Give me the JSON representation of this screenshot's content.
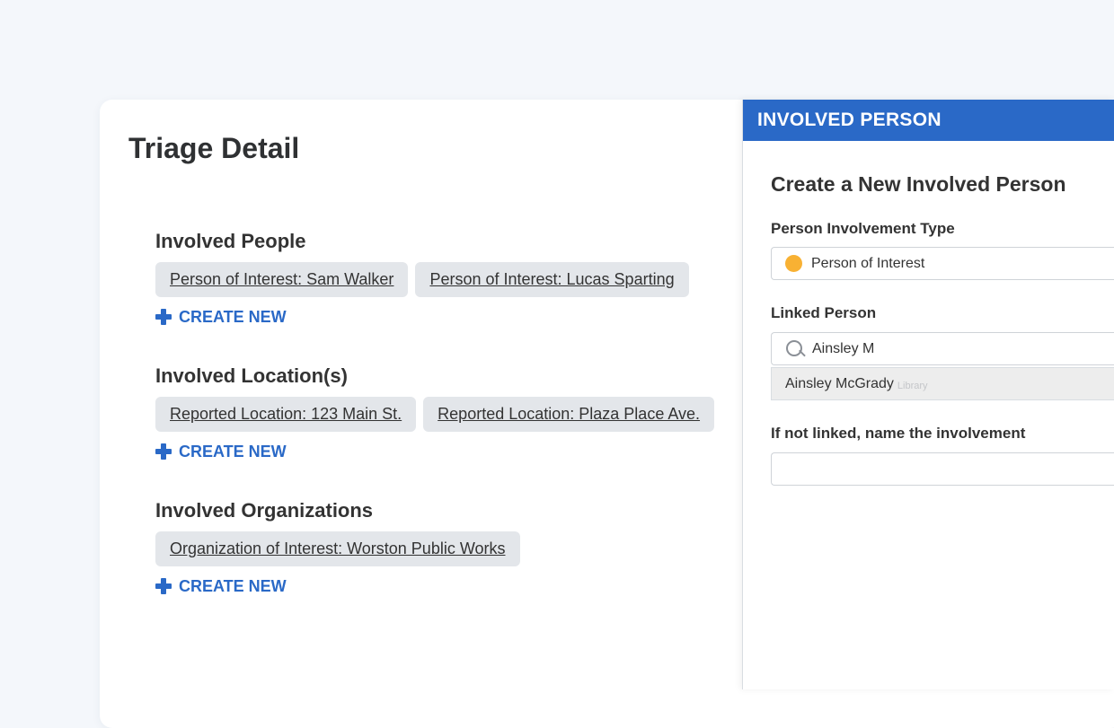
{
  "page": {
    "title": "Triage Detail"
  },
  "sections": [
    {
      "title": "Involved People",
      "items": [
        "Person of Interest: Sam Walker",
        "Person of Interest: Lucas Sparting"
      ],
      "create_label": "CREATE NEW"
    },
    {
      "title": "Involved Location(s)",
      "items": [
        "Reported Location: 123 Main St.",
        "Reported Location: Plaza Place Ave."
      ],
      "create_label": "CREATE NEW"
    },
    {
      "title": "Involved Organizations",
      "items": [
        "Organization of Interest: Worston Public Works"
      ],
      "create_label": "CREATE NEW"
    }
  ],
  "panel": {
    "header": "INVOLVED PERSON",
    "title": "Create a New Involved Person",
    "involvement_type": {
      "label": "Person Involvement Type",
      "value": "Person of Interest",
      "dot_color": "#f8b133"
    },
    "linked_person": {
      "label": "Linked Person",
      "query": "Ainsley M",
      "suggestion": {
        "name": "Ainsley McGrady",
        "source": "Library"
      }
    },
    "unlinked_name": {
      "label": "If not linked, name the involvement",
      "value": ""
    }
  },
  "colors": {
    "accent": "#2a69c7",
    "chip_bg": "#e3e6ea"
  },
  "icons": {
    "create": "plus-icon",
    "search": "search-icon",
    "type": "dot-icon"
  }
}
